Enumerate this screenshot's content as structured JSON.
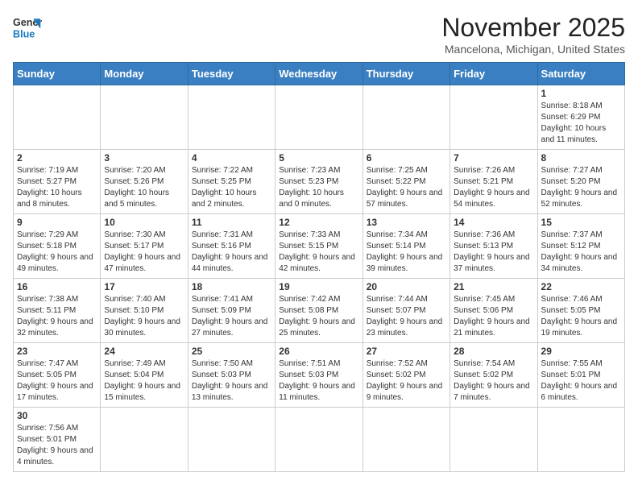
{
  "header": {
    "logo_line1": "General",
    "logo_line2": "Blue",
    "title": "November 2025",
    "subtitle": "Mancelona, Michigan, United States"
  },
  "days_of_week": [
    "Sunday",
    "Monday",
    "Tuesday",
    "Wednesday",
    "Thursday",
    "Friday",
    "Saturday"
  ],
  "weeks": [
    [
      {
        "day": "",
        "info": ""
      },
      {
        "day": "",
        "info": ""
      },
      {
        "day": "",
        "info": ""
      },
      {
        "day": "",
        "info": ""
      },
      {
        "day": "",
        "info": ""
      },
      {
        "day": "",
        "info": ""
      },
      {
        "day": "1",
        "info": "Sunrise: 8:18 AM\nSunset: 6:29 PM\nDaylight: 10 hours and 11 minutes."
      }
    ],
    [
      {
        "day": "2",
        "info": "Sunrise: 7:19 AM\nSunset: 5:27 PM\nDaylight: 10 hours and 8 minutes."
      },
      {
        "day": "3",
        "info": "Sunrise: 7:20 AM\nSunset: 5:26 PM\nDaylight: 10 hours and 5 minutes."
      },
      {
        "day": "4",
        "info": "Sunrise: 7:22 AM\nSunset: 5:25 PM\nDaylight: 10 hours and 2 minutes."
      },
      {
        "day": "5",
        "info": "Sunrise: 7:23 AM\nSunset: 5:23 PM\nDaylight: 10 hours and 0 minutes."
      },
      {
        "day": "6",
        "info": "Sunrise: 7:25 AM\nSunset: 5:22 PM\nDaylight: 9 hours and 57 minutes."
      },
      {
        "day": "7",
        "info": "Sunrise: 7:26 AM\nSunset: 5:21 PM\nDaylight: 9 hours and 54 minutes."
      },
      {
        "day": "8",
        "info": "Sunrise: 7:27 AM\nSunset: 5:20 PM\nDaylight: 9 hours and 52 minutes."
      }
    ],
    [
      {
        "day": "9",
        "info": "Sunrise: 7:29 AM\nSunset: 5:18 PM\nDaylight: 9 hours and 49 minutes."
      },
      {
        "day": "10",
        "info": "Sunrise: 7:30 AM\nSunset: 5:17 PM\nDaylight: 9 hours and 47 minutes."
      },
      {
        "day": "11",
        "info": "Sunrise: 7:31 AM\nSunset: 5:16 PM\nDaylight: 9 hours and 44 minutes."
      },
      {
        "day": "12",
        "info": "Sunrise: 7:33 AM\nSunset: 5:15 PM\nDaylight: 9 hours and 42 minutes."
      },
      {
        "day": "13",
        "info": "Sunrise: 7:34 AM\nSunset: 5:14 PM\nDaylight: 9 hours and 39 minutes."
      },
      {
        "day": "14",
        "info": "Sunrise: 7:36 AM\nSunset: 5:13 PM\nDaylight: 9 hours and 37 minutes."
      },
      {
        "day": "15",
        "info": "Sunrise: 7:37 AM\nSunset: 5:12 PM\nDaylight: 9 hours and 34 minutes."
      }
    ],
    [
      {
        "day": "16",
        "info": "Sunrise: 7:38 AM\nSunset: 5:11 PM\nDaylight: 9 hours and 32 minutes."
      },
      {
        "day": "17",
        "info": "Sunrise: 7:40 AM\nSunset: 5:10 PM\nDaylight: 9 hours and 30 minutes."
      },
      {
        "day": "18",
        "info": "Sunrise: 7:41 AM\nSunset: 5:09 PM\nDaylight: 9 hours and 27 minutes."
      },
      {
        "day": "19",
        "info": "Sunrise: 7:42 AM\nSunset: 5:08 PM\nDaylight: 9 hours and 25 minutes."
      },
      {
        "day": "20",
        "info": "Sunrise: 7:44 AM\nSunset: 5:07 PM\nDaylight: 9 hours and 23 minutes."
      },
      {
        "day": "21",
        "info": "Sunrise: 7:45 AM\nSunset: 5:06 PM\nDaylight: 9 hours and 21 minutes."
      },
      {
        "day": "22",
        "info": "Sunrise: 7:46 AM\nSunset: 5:05 PM\nDaylight: 9 hours and 19 minutes."
      }
    ],
    [
      {
        "day": "23",
        "info": "Sunrise: 7:47 AM\nSunset: 5:05 PM\nDaylight: 9 hours and 17 minutes."
      },
      {
        "day": "24",
        "info": "Sunrise: 7:49 AM\nSunset: 5:04 PM\nDaylight: 9 hours and 15 minutes."
      },
      {
        "day": "25",
        "info": "Sunrise: 7:50 AM\nSunset: 5:03 PM\nDaylight: 9 hours and 13 minutes."
      },
      {
        "day": "26",
        "info": "Sunrise: 7:51 AM\nSunset: 5:03 PM\nDaylight: 9 hours and 11 minutes."
      },
      {
        "day": "27",
        "info": "Sunrise: 7:52 AM\nSunset: 5:02 PM\nDaylight: 9 hours and 9 minutes."
      },
      {
        "day": "28",
        "info": "Sunrise: 7:54 AM\nSunset: 5:02 PM\nDaylight: 9 hours and 7 minutes."
      },
      {
        "day": "29",
        "info": "Sunrise: 7:55 AM\nSunset: 5:01 PM\nDaylight: 9 hours and 6 minutes."
      }
    ],
    [
      {
        "day": "30",
        "info": "Sunrise: 7:56 AM\nSunset: 5:01 PM\nDaylight: 9 hours and 4 minutes."
      },
      {
        "day": "",
        "info": ""
      },
      {
        "day": "",
        "info": ""
      },
      {
        "day": "",
        "info": ""
      },
      {
        "day": "",
        "info": ""
      },
      {
        "day": "",
        "info": ""
      },
      {
        "day": "",
        "info": ""
      }
    ]
  ]
}
